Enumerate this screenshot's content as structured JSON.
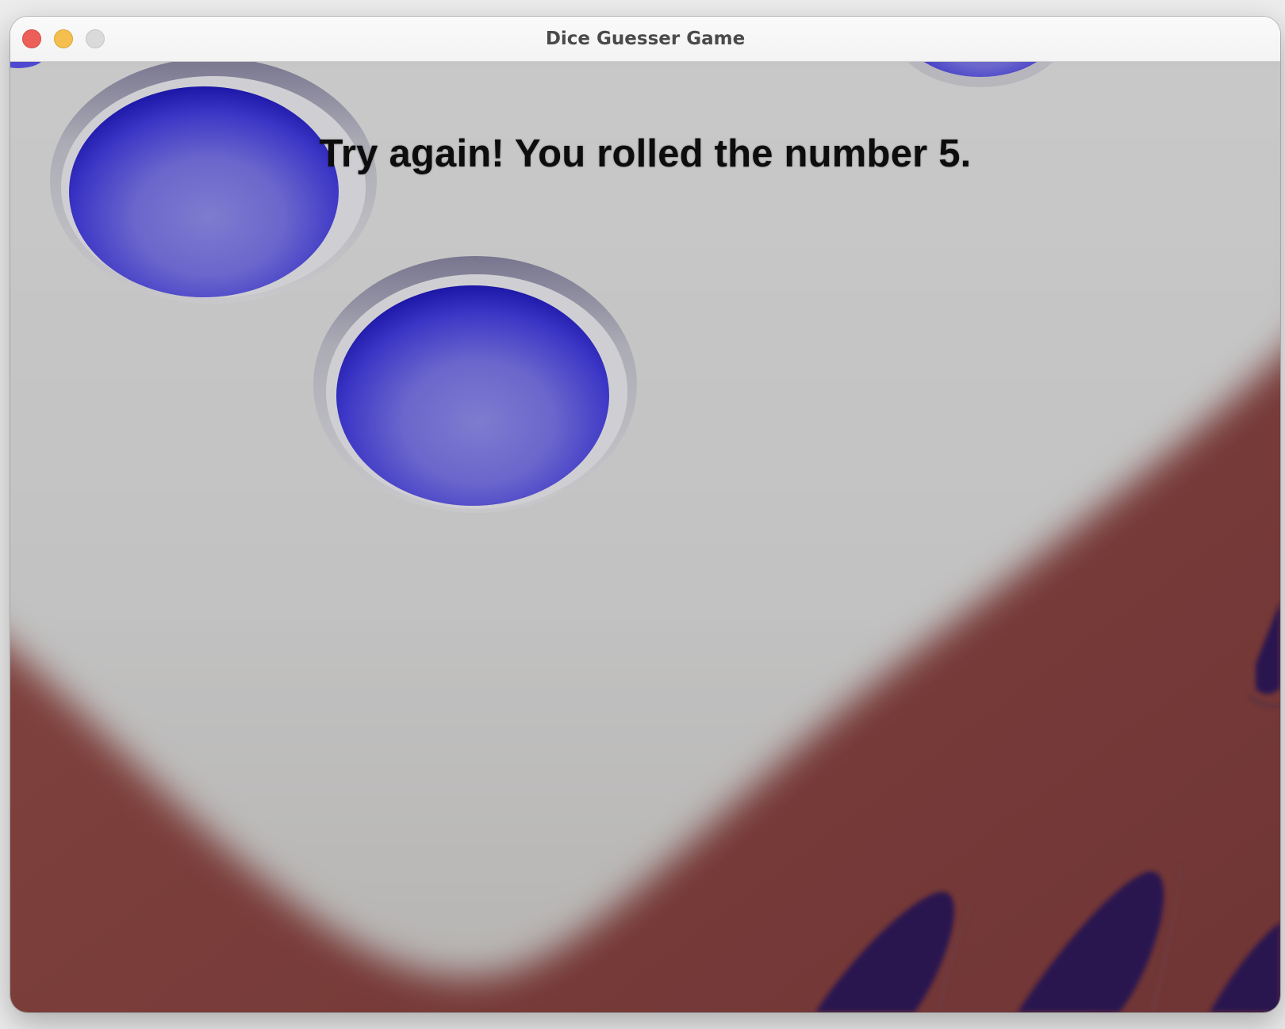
{
  "window": {
    "title": "Dice Guesser Game"
  },
  "game": {
    "message": "Try again! You rolled the number 5.",
    "rolled_number": 5,
    "colors": {
      "die_face": "#c4c4c4",
      "pip": "#3a34c4",
      "table_background": "#7a3b38",
      "message_text": "#0d0d0d"
    }
  }
}
